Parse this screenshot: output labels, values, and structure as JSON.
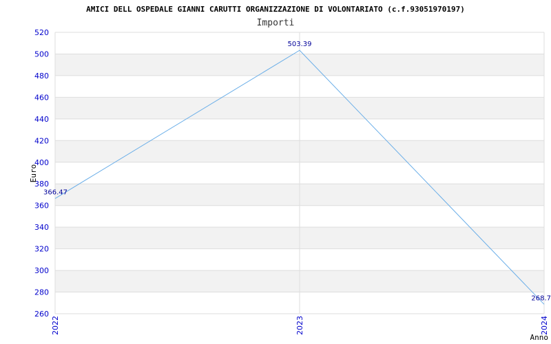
{
  "chart_data": {
    "type": "line",
    "title": "AMICI DELL OSPEDALE GIANNI CARUTTI ORGANIZZAZIONE DI VOLONTARIATO (c.f.93051970197)",
    "subtitle": "Importi",
    "xlabel": "Anno",
    "ylabel": "Euro",
    "categories": [
      "2022",
      "2023",
      "2024"
    ],
    "series": [
      {
        "values": [
          366.47,
          503.39,
          268.7
        ],
        "labels": [
          "366.47",
          "503.39",
          "268.7"
        ]
      }
    ],
    "ylim": [
      260,
      520
    ],
    "yticks": [
      260,
      280,
      300,
      320,
      340,
      360,
      380,
      400,
      420,
      440,
      460,
      480,
      500,
      520
    ],
    "grid": true,
    "colors": {
      "line": "#6aaee8",
      "band": "#f2f2f2",
      "grid": "#dddddd",
      "tick": "#0000cc",
      "data_label": "#000099"
    }
  }
}
